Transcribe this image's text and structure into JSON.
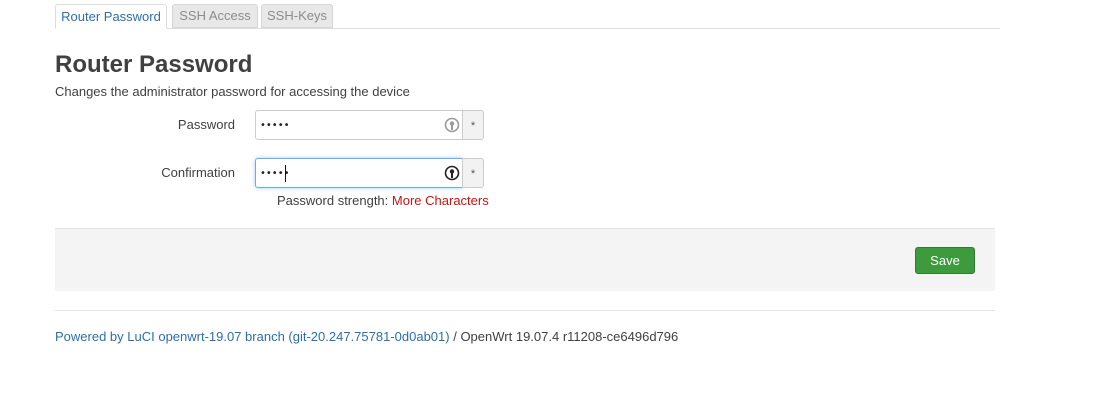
{
  "tabs": [
    {
      "label": "Router Password",
      "active": true
    },
    {
      "label": "SSH Access",
      "active": false
    },
    {
      "label": "SSH-Keys",
      "active": false
    }
  ],
  "page": {
    "title": "Router Password",
    "description": "Changes the administrator password for accessing the device"
  },
  "form": {
    "password": {
      "label": "Password",
      "value": "•••••",
      "addon": "*"
    },
    "confirmation": {
      "label": "Confirmation",
      "value": "•••••",
      "addon": "*"
    },
    "strength": {
      "prefix": "Password strength:",
      "value": "More Characters"
    }
  },
  "actions": {
    "save_label": "Save"
  },
  "footer": {
    "link_text": "Powered by LuCI openwrt-19.07 branch (git-20.247.75781-0d0ab01)",
    "version": " / OpenWrt 19.07.4 r11208-ce6496d796"
  },
  "colors": {
    "link": "#2a6fb0",
    "save_button": "#3d9a3d",
    "strength_warning": "#cc1111",
    "focus_border": "#66afe9"
  },
  "icons": {
    "reveal_password": "eye-toggle-icon"
  }
}
